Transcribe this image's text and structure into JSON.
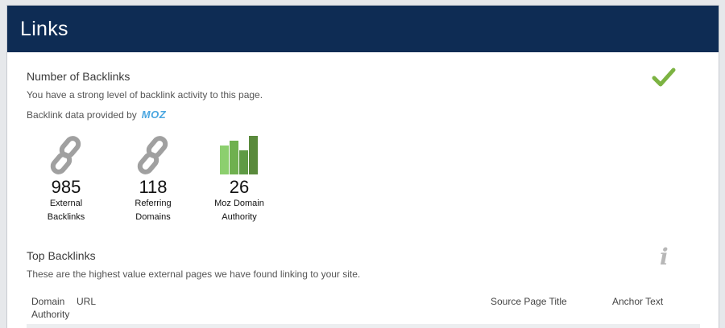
{
  "header": {
    "title": "Links"
  },
  "backlinks": {
    "title": "Number of Backlinks",
    "description": "You have a strong level of backlink activity to this page.",
    "provided_by": "Backlink data provided by",
    "provider_logo_text": "MOZ",
    "status_icon": "check-icon",
    "metrics": [
      {
        "value": "985",
        "label_line1": "External",
        "label_line2": "Backlinks",
        "icon": "chain-link-icon"
      },
      {
        "value": "118",
        "label_line1": "Referring",
        "label_line2": "Domains",
        "icon": "chain-link-icon"
      },
      {
        "value": "26",
        "label_line1": "Moz Domain",
        "label_line2": "Authority",
        "icon": "bar-chart-icon"
      }
    ]
  },
  "top_backlinks": {
    "title": "Top Backlinks",
    "description": "These are the highest value external pages we have found linking to your site.",
    "info_icon": "info-icon",
    "columns": {
      "domain_authority_line1": "Domain",
      "domain_authority_line2": "Authority",
      "url": "URL",
      "source_page_title": "Source Page Title",
      "anchor_text": "Anchor Text"
    }
  },
  "colors": {
    "header_bg": "#0e2c54",
    "check": "#7cb342",
    "chain": "#a0a0a0",
    "bar_light": "#8ccf6e",
    "bar_dark": "#5a8a3c"
  }
}
